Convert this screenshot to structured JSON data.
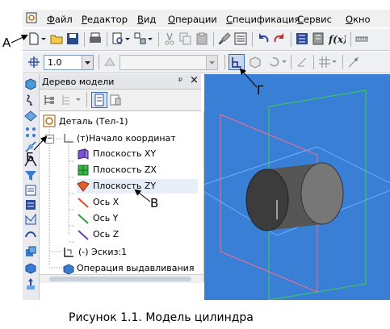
{
  "menu": {
    "items": [
      {
        "first": "Ф",
        "rest": "айл"
      },
      {
        "first": "Р",
        "rest": "едактор"
      },
      {
        "first": "В",
        "rest": "ид"
      },
      {
        "first": "О",
        "rest": "перации"
      },
      {
        "first": "С",
        "rest": "пецификация"
      },
      {
        "first": "С",
        "rest": "ервис"
      },
      {
        "first": "О",
        "rest": "кно"
      }
    ]
  },
  "toolbar2": {
    "step_value": "1.0"
  },
  "tree_panel": {
    "title": "Дерево модели",
    "pin_glyph": "ᵖ",
    "close_glyph": "×",
    "items": [
      {
        "label": "Деталь (Тел-1)"
      },
      {
        "label": "(т)Начало координат"
      },
      {
        "label": "Плоскость XY"
      },
      {
        "label": "Плоскость ZX"
      },
      {
        "label": "Плоскость ZY"
      },
      {
        "label": "Ось X"
      },
      {
        "label": "Ось Y"
      },
      {
        "label": "Ось Z"
      },
      {
        "label": "(-) Эскиз:1"
      },
      {
        "label": "Операция выдавливания"
      }
    ],
    "expander_glyph": "−"
  },
  "callouts": {
    "a": "А",
    "b": "Б",
    "v": "В",
    "g": "Г"
  },
  "caption": "Рисунок 1.1. Модель цилиндра",
  "colors": {
    "viewport": "#3a7fd6",
    "plane_xy": "#7a56c8",
    "plane_zx": "#3cb34a",
    "plane_zy": "#e0602a",
    "axis_x": "#e24a2a",
    "axis_y": "#2e9e3a",
    "axis_z": "#6a3fc0",
    "cylinder": "#4a4a4a"
  }
}
